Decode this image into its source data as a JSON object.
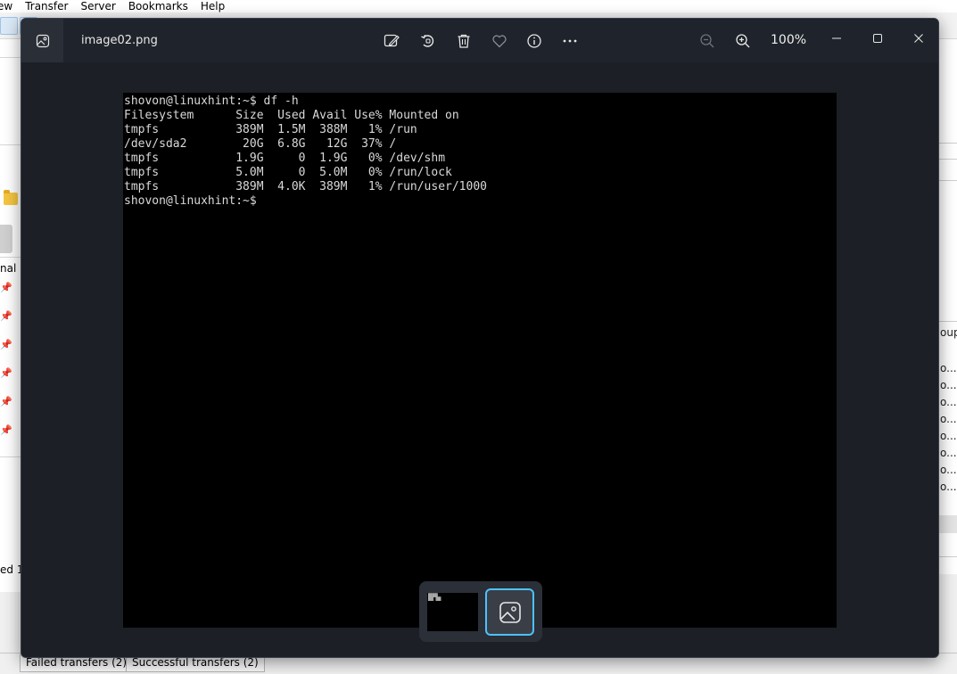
{
  "background_app": {
    "menu": [
      "ew",
      "Transfer",
      "Server",
      "Bookmarks",
      "Help"
    ],
    "left_partial_label": "nal",
    "bottom_left_partial": "ed  1",
    "right_partial": {
      "header": "oup",
      "rows": [
        "o...",
        "o...",
        "o...",
        "o...",
        "o...",
        "o...",
        "o...",
        "o..."
      ]
    },
    "bottom_tabs": [
      "Failed transfers (2)",
      "Successful transfers (2)"
    ]
  },
  "viewer": {
    "file_name": "image02.png",
    "zoom_level": "100%",
    "toolbar_icons": [
      "edit-image-icon",
      "rotate-icon",
      "delete-icon",
      "favorite-icon",
      "info-icon",
      "more-icon"
    ],
    "zoom_icons": [
      "zoom-out-icon",
      "zoom-in-icon"
    ],
    "window_controls": [
      "minimize-icon",
      "maximize-icon",
      "close-icon"
    ],
    "accent_color": "#4cc2ff"
  },
  "terminal": {
    "lines": [
      "shovon@linuxhint:~$ df -h",
      "Filesystem      Size  Used Avail Use% Mounted on",
      "tmpfs           389M  1.5M  388M   1% /run",
      "/dev/sda2        20G  6.8G   12G  37% /",
      "tmpfs           1.9G     0  1.9G   0% /dev/shm",
      "tmpfs           5.0M     0  5.0M   0% /run/lock",
      "tmpfs           389M  4.0K  389M   1% /run/user/1000",
      "shovon@linuxhint:~$"
    ]
  }
}
